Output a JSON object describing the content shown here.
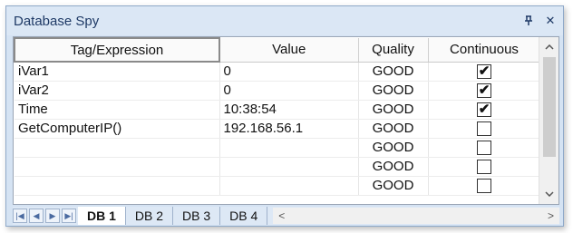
{
  "panel": {
    "title": "Database Spy",
    "pin_glyph": "ᵽ",
    "close_glyph": "✕"
  },
  "grid": {
    "columns": [
      "Tag/Expression",
      "Value",
      "Quality",
      "Continuous"
    ],
    "rows": [
      {
        "tag": "iVar1",
        "value": "0",
        "quality": "GOOD",
        "continuous": true
      },
      {
        "tag": "iVar2",
        "value": "0",
        "quality": "GOOD",
        "continuous": true
      },
      {
        "tag": "Time",
        "value": "10:38:54",
        "quality": "GOOD",
        "continuous": true
      },
      {
        "tag": "GetComputerIP()",
        "value": "192.168.56.1",
        "quality": "GOOD",
        "continuous": false
      },
      {
        "tag": "",
        "value": "",
        "quality": "GOOD",
        "continuous": false
      },
      {
        "tag": "",
        "value": "",
        "quality": "GOOD",
        "continuous": false
      },
      {
        "tag": "",
        "value": "",
        "quality": "GOOD",
        "continuous": false
      }
    ]
  },
  "tabs": [
    "DB 1",
    "DB 2",
    "DB 3",
    "DB 4"
  ],
  "active_tab": "DB 1",
  "colors": {
    "title_text": "#1f3a66",
    "panel_bg": "#d5e3f3"
  }
}
